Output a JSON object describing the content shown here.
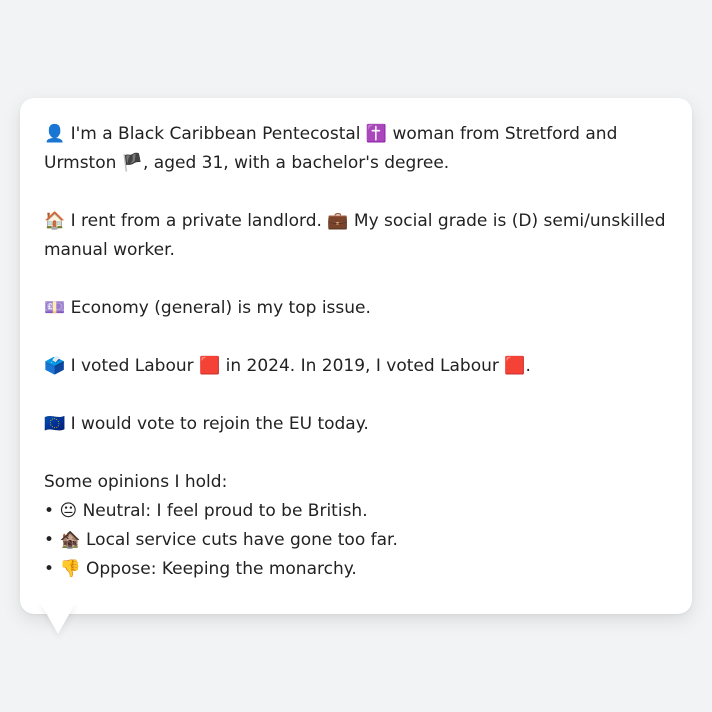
{
  "persona": {
    "intro": {
      "icon_1": "👤",
      "text_1": " I'm a Black Caribbean Pentecostal ",
      "icon_2": "✝️",
      "text_2": " woman from Stretford and Urmston ",
      "icon_3": "🏴",
      "text_3": ", aged 31, with a bachelor's degree."
    },
    "housing": {
      "icon_1": "🏠",
      "text_1": " I rent from a private landlord. ",
      "icon_2": "💼",
      "text_2": " My social grade is (D) semi/unskilled manual worker."
    },
    "issue": {
      "icon": "💷",
      "text": " Economy (general) is my top issue."
    },
    "vote": {
      "icon_1": "🗳️",
      "text_1": " I voted Labour ",
      "icon_2": "🟥",
      "text_2": " in 2024. In 2019, I voted Labour ",
      "icon_3": "🟥",
      "text_3": "."
    },
    "eu": {
      "icon": "🇪🇺",
      "text": " I would vote to rejoin the EU today."
    },
    "opinions_heading": "Some opinions I hold:",
    "opinions": [
      {
        "bullet": "•",
        "icon": "😐",
        "text": " Neutral: I feel proud to be British."
      },
      {
        "bullet": "•",
        "icon": "🏚️",
        "text": " Local service cuts have gone too far."
      },
      {
        "bullet": "•",
        "icon": "👎",
        "text": " Oppose: Keeping the monarchy."
      }
    ]
  }
}
